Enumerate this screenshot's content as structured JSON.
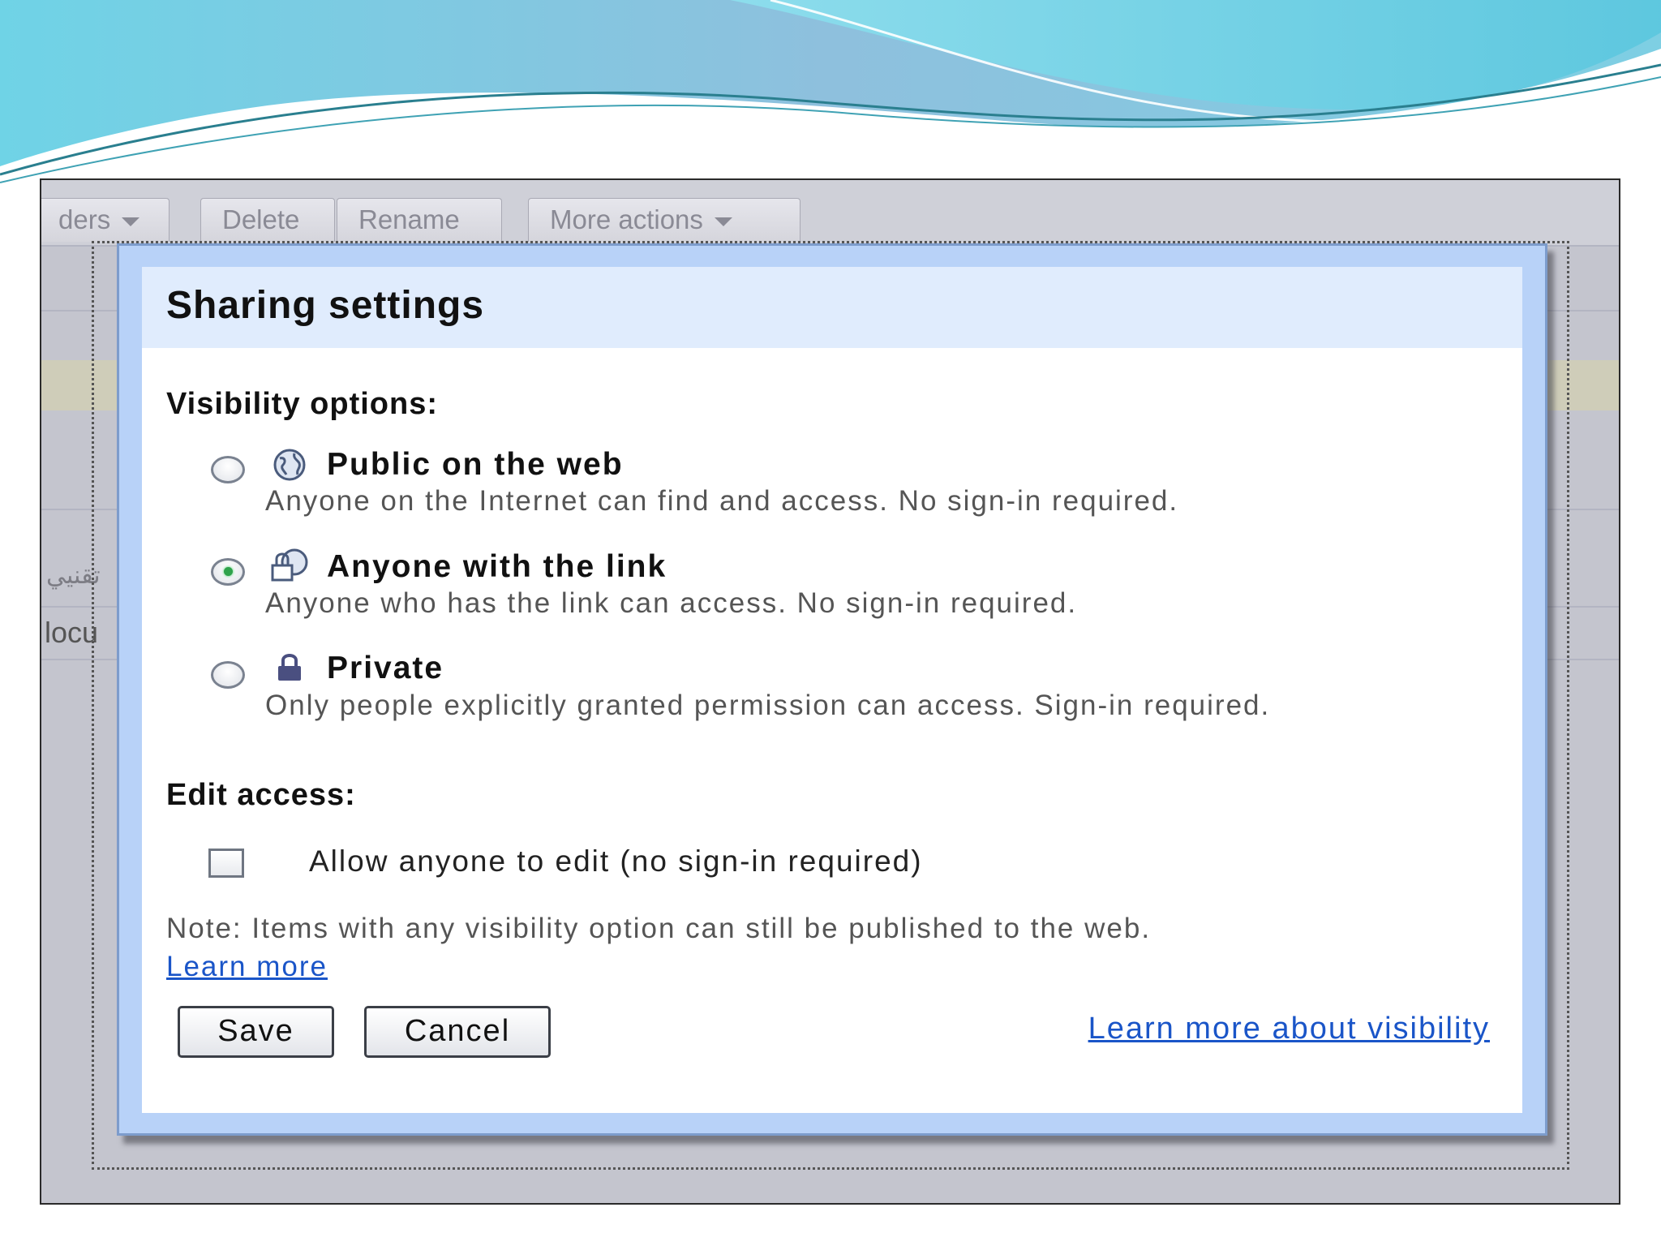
{
  "toolbar": {
    "folders_label": "ders",
    "delete_label": "Delete",
    "rename_label": "Rename",
    "more_actions_label": "More actions"
  },
  "background": {
    "row_text_1": "تقنيي",
    "row_text_2": "locu"
  },
  "dialog": {
    "title": "Sharing settings",
    "visibility_heading": "Visibility options:",
    "options": [
      {
        "label": "Public on the web",
        "description": "Anyone on the Internet can find and access. No sign-in required.",
        "icon": "globe-icon",
        "selected": false
      },
      {
        "label": "Anyone with the link",
        "description": "Anyone who has the link can access. No sign-in required.",
        "icon": "link-lock-icon",
        "selected": true
      },
      {
        "label": "Private",
        "description": "Only people explicitly granted permission can access. Sign-in required.",
        "icon": "lock-icon",
        "selected": false
      }
    ],
    "edit_heading": "Edit access:",
    "edit_checkbox_label": "Allow anyone to edit (no sign-in required)",
    "edit_checked": false,
    "note": "Note: Items with any visibility option can still be published to the web.",
    "learn_more": "Learn more",
    "save_label": "Save",
    "cancel_label": "Cancel",
    "learn_more_visibility": "Learn more about visibility"
  },
  "colors": {
    "link": "#1a55c8",
    "dialog_border": "#b8d2f8",
    "header_bg": "#e0ecfd",
    "selected_radio": "#2fa24b"
  }
}
